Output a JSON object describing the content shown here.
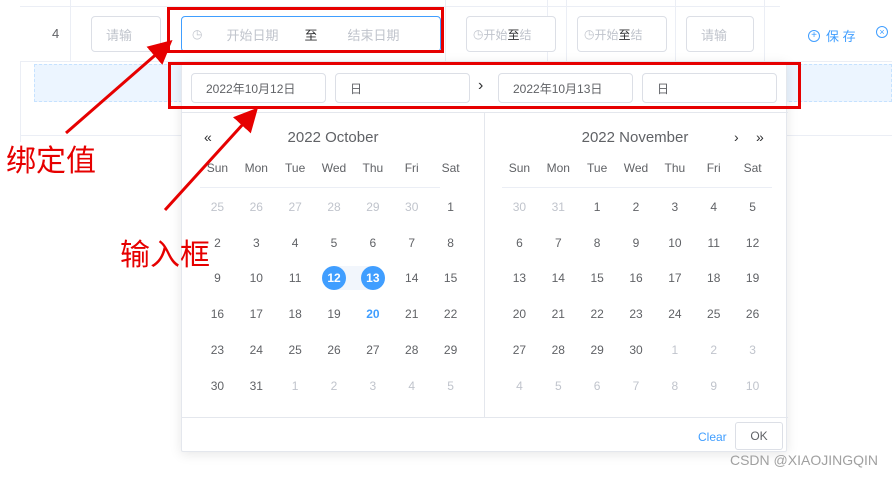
{
  "table": {
    "row_index": "4",
    "input_placeholder": "请输",
    "range": {
      "start_placeholder": "开始日期",
      "separator": "至",
      "end_placeholder": "结束日期"
    },
    "mini_range_1": {
      "start": "开始",
      "sep": "至",
      "end": "结"
    },
    "mini_range_2": {
      "start": "开始",
      "sep": "至",
      "end": "结"
    },
    "last_input_placeholder": "请输",
    "actions": {
      "save": "保 存"
    }
  },
  "picker": {
    "start_date": "2022年10月12日",
    "start_time": "日",
    "end_date": "2022年10月13日",
    "end_time": "日",
    "weekdays": [
      "Sun",
      "Mon",
      "Tue",
      "Wed",
      "Thu",
      "Fri",
      "Sat"
    ],
    "left": {
      "title": "2022 October",
      "prev_year": "«",
      "weeks": [
        [
          {
            "d": "25",
            "m": 1
          },
          {
            "d": "26",
            "m": 1
          },
          {
            "d": "27",
            "m": 1
          },
          {
            "d": "28",
            "m": 1
          },
          {
            "d": "29",
            "m": 1
          },
          {
            "d": "30",
            "m": 1
          },
          {
            "d": "1"
          }
        ],
        [
          {
            "d": "2"
          },
          {
            "d": "3"
          },
          {
            "d": "4"
          },
          {
            "d": "5"
          },
          {
            "d": "6"
          },
          {
            "d": "7"
          },
          {
            "d": "8"
          }
        ],
        [
          {
            "d": "9"
          },
          {
            "d": "10"
          },
          {
            "d": "11"
          },
          {
            "d": "12",
            "s": "start"
          },
          {
            "d": "13",
            "s": "end"
          },
          {
            "d": "14"
          },
          {
            "d": "15"
          }
        ],
        [
          {
            "d": "16"
          },
          {
            "d": "17"
          },
          {
            "d": "18"
          },
          {
            "d": "19"
          },
          {
            "d": "20",
            "t": 1
          },
          {
            "d": "21"
          },
          {
            "d": "22"
          }
        ],
        [
          {
            "d": "23"
          },
          {
            "d": "24"
          },
          {
            "d": "25"
          },
          {
            "d": "26"
          },
          {
            "d": "27"
          },
          {
            "d": "28"
          },
          {
            "d": "29"
          }
        ],
        [
          {
            "d": "30"
          },
          {
            "d": "31"
          },
          {
            "d": "1",
            "m": 1
          },
          {
            "d": "2",
            "m": 1
          },
          {
            "d": "3",
            "m": 1
          },
          {
            "d": "4",
            "m": 1
          },
          {
            "d": "5",
            "m": 1
          }
        ]
      ]
    },
    "right": {
      "title": "2022 November",
      "next_month": "›",
      "next_year": "»",
      "weeks": [
        [
          {
            "d": "30",
            "m": 1
          },
          {
            "d": "31",
            "m": 1
          },
          {
            "d": "1"
          },
          {
            "d": "2"
          },
          {
            "d": "3"
          },
          {
            "d": "4"
          },
          {
            "d": "5"
          }
        ],
        [
          {
            "d": "6"
          },
          {
            "d": "7"
          },
          {
            "d": "8"
          },
          {
            "d": "9"
          },
          {
            "d": "10"
          },
          {
            "d": "11"
          },
          {
            "d": "12"
          }
        ],
        [
          {
            "d": "13"
          },
          {
            "d": "14"
          },
          {
            "d": "15"
          },
          {
            "d": "16"
          },
          {
            "d": "17"
          },
          {
            "d": "18"
          },
          {
            "d": "19"
          }
        ],
        [
          {
            "d": "20"
          },
          {
            "d": "21"
          },
          {
            "d": "22"
          },
          {
            "d": "23"
          },
          {
            "d": "24"
          },
          {
            "d": "25"
          },
          {
            "d": "26"
          }
        ],
        [
          {
            "d": "27"
          },
          {
            "d": "28"
          },
          {
            "d": "29"
          },
          {
            "d": "30"
          },
          {
            "d": "1",
            "m": 1
          },
          {
            "d": "2",
            "m": 1
          },
          {
            "d": "3",
            "m": 1
          }
        ],
        [
          {
            "d": "4",
            "m": 1
          },
          {
            "d": "5",
            "m": 1
          },
          {
            "d": "6",
            "m": 1
          },
          {
            "d": "7",
            "m": 1
          },
          {
            "d": "8",
            "m": 1
          },
          {
            "d": "9",
            "m": 1
          },
          {
            "d": "10",
            "m": 1
          }
        ]
      ]
    },
    "clear_label": "Clear",
    "ok_label": "OK"
  },
  "annotations": {
    "bound_value": "绑定值",
    "input_box": "输入框",
    "color": "#e60000"
  },
  "watermark": "CSDN @XIAOJINGQIN"
}
